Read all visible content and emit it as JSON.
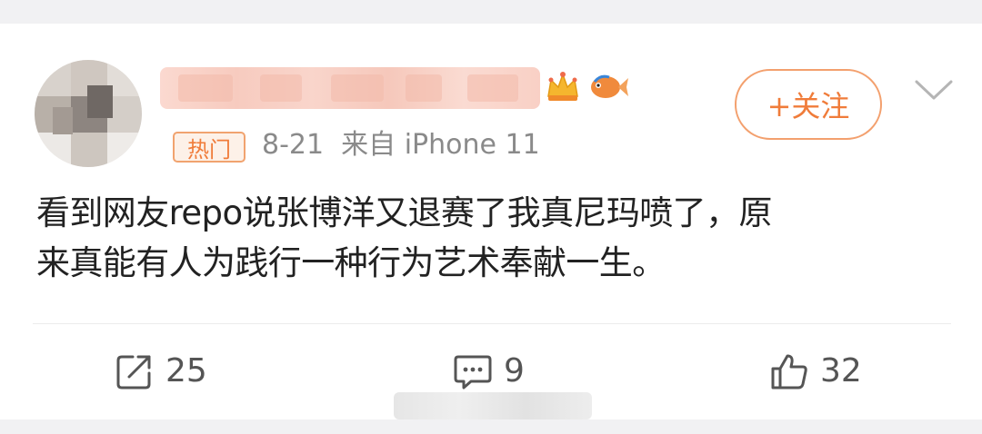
{
  "post": {
    "badge": "热门",
    "date": "8-21",
    "source": "来自 iPhone 11",
    "content": "看到网友repo说张博洋又退赛了我真尼玛喷了，原\n来真能有人为践行一种行为艺术奉献一生。"
  },
  "follow_button": {
    "label": "+关注"
  },
  "actions": {
    "repost": {
      "icon": "share-icon",
      "count": "25"
    },
    "comment": {
      "icon": "comment-icon",
      "count": "9"
    },
    "like": {
      "icon": "thumbs-up-icon",
      "count": "32"
    }
  },
  "colors": {
    "accent": "#f07c3a",
    "text": "#222222",
    "meta": "#8a8a8a",
    "icon": "#555555"
  }
}
